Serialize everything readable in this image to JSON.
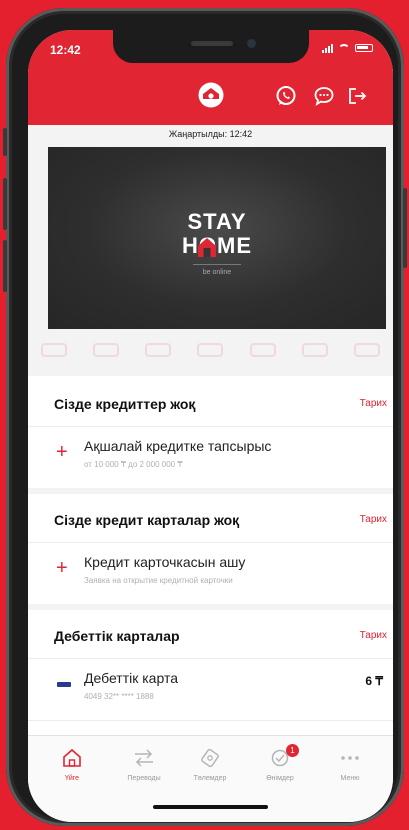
{
  "status_bar": {
    "time": "12:42"
  },
  "header": {
    "updated_text": "Жаңартылды: 12:42",
    "icons": [
      "home-credit-logo",
      "whatsapp-icon",
      "chat-icon",
      "logout-icon"
    ]
  },
  "banner": {
    "line1": "STAY",
    "line2": "HOME",
    "subtitle": "be online"
  },
  "sections": {
    "credits": {
      "title": "Сізде кредиттер жоқ",
      "link": "Тарих",
      "item_title": "Ақшалай кредитке тапсырыс",
      "item_sub": "от 10 000 ₸ до 2 000 000 ₸"
    },
    "credit_cards": {
      "title": "Сізде кредит карталар жоқ",
      "link": "Тарих",
      "item_title": "Кредит карточкасын ашу",
      "item_sub": "Заявка на открытие кредитной карточки"
    },
    "debit_cards": {
      "title": "Дебеттік карталар",
      "link": "Тарих",
      "item_title": "Дебеттік карта",
      "item_sub": "4049 32** **** 1888",
      "amount": "6 ₸"
    }
  },
  "tabbar": {
    "tabs": [
      {
        "label": "Үйге",
        "icon": "home-icon",
        "active": true
      },
      {
        "label": "Переводы",
        "icon": "transfer-icon",
        "active": false
      },
      {
        "label": "Төлемдер",
        "icon": "payments-icon",
        "active": false
      },
      {
        "label": "Өнімдер",
        "icon": "products-icon",
        "active": false,
        "badge": "1"
      },
      {
        "label": "Меню",
        "icon": "more-icon",
        "active": false
      }
    ]
  },
  "colors": {
    "brand": "#e12532",
    "background": "#e4202e"
  }
}
